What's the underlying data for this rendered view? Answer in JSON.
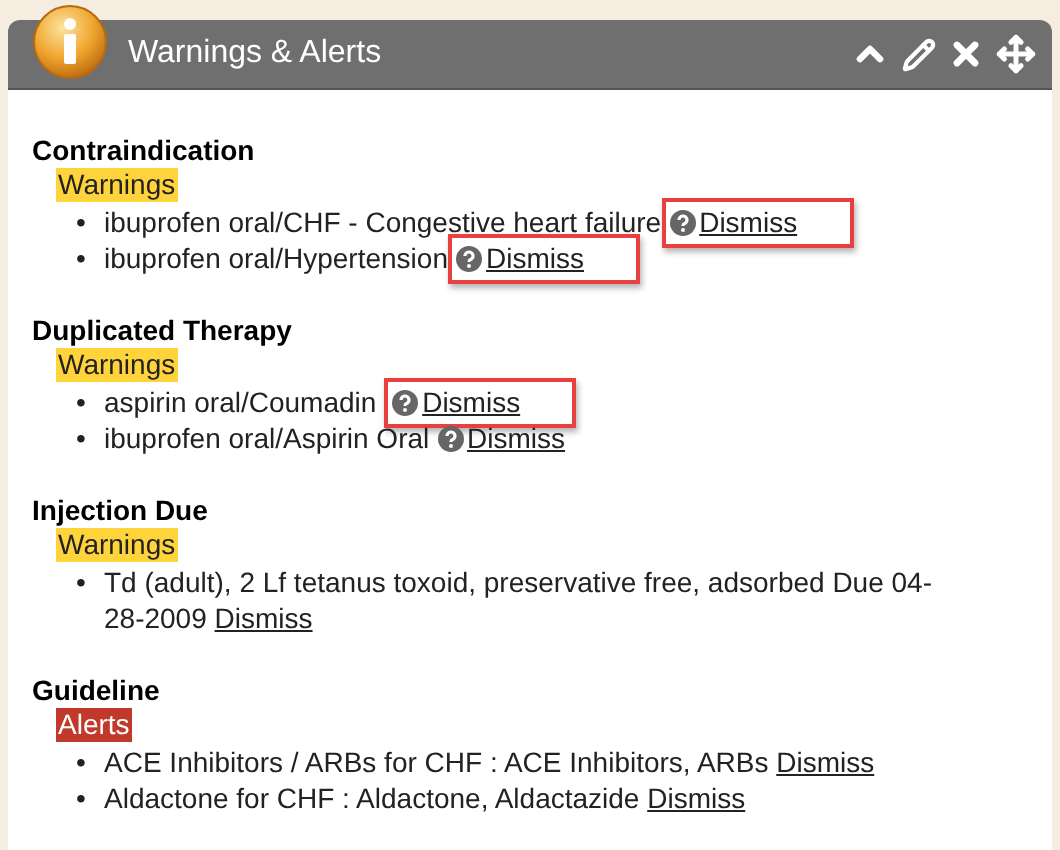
{
  "panel": {
    "title": "Warnings & Alerts"
  },
  "bullet": "•",
  "sections": [
    {
      "title": "Contraindication",
      "badge": {
        "label": "Warnings",
        "kind": "warning"
      },
      "items": [
        {
          "text": "ibuprofen oral/CHF - Congestive heart failure",
          "help": true,
          "dismiss": "Dismiss",
          "flagged": true
        },
        {
          "text": "ibuprofen oral/Hypertension",
          "help": true,
          "dismiss": "Dismiss",
          "flagged": true
        }
      ]
    },
    {
      "title": "Duplicated Therapy",
      "badge": {
        "label": "Warnings",
        "kind": "warning"
      },
      "items": [
        {
          "text": "aspirin oral/Coumadin ",
          "help": true,
          "dismiss": "Dismiss",
          "flagged": true
        },
        {
          "text": "ibuprofen oral/Aspirin Oral ",
          "help": true,
          "dismiss": "Dismiss",
          "flagged": false
        }
      ]
    },
    {
      "title": "Injection Due",
      "badge": {
        "label": "Warnings",
        "kind": "warning"
      },
      "items": [
        {
          "text": "Td (adult), 2 Lf tetanus toxoid, preservative free, adsorbed Due 04-28-2009 ",
          "help": false,
          "dismiss": "Dismiss",
          "flagged": false
        }
      ]
    },
    {
      "title": "Guideline",
      "badge": {
        "label": "Alerts",
        "kind": "alert"
      },
      "items": [
        {
          "text": "ACE Inhibitors / ARBs for CHF : ACE Inhibitors, ARBs ",
          "help": false,
          "dismiss": "Dismiss",
          "flagged": false
        },
        {
          "text": "Aldactone for CHF : Aldactone, Aldactazide ",
          "help": false,
          "dismiss": "Dismiss",
          "flagged": false
        }
      ]
    }
  ]
}
